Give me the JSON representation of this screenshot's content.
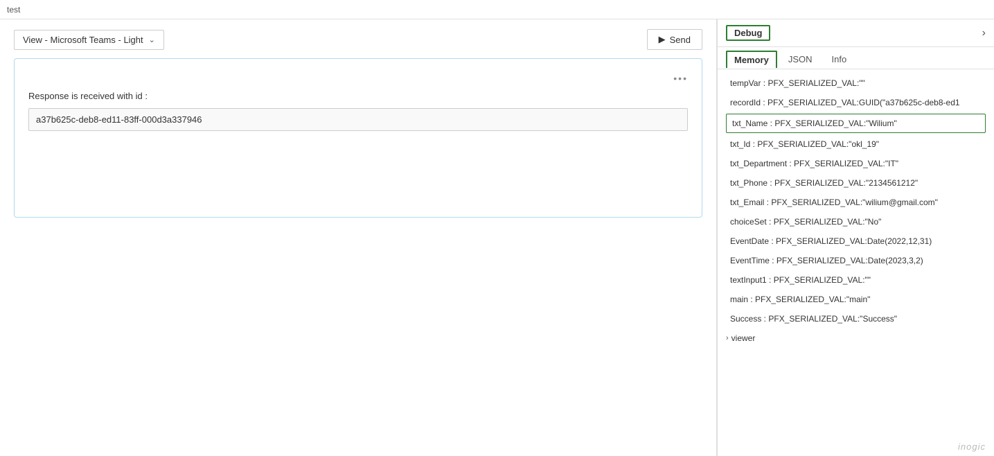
{
  "topbar": {
    "title": "test"
  },
  "toolbar": {
    "view_label": "View - Microsoft Teams - Light",
    "send_label": "Send",
    "send_icon": "▷"
  },
  "card": {
    "options_icon": "•••",
    "response_label": "Response is received with id :",
    "record_id": "a37b625c-deb8-ed11-83ff-000d3a337946"
  },
  "debug": {
    "title": "Debug",
    "chevron": "›",
    "tabs": [
      {
        "label": "Memory",
        "active": true
      },
      {
        "label": "JSON",
        "active": false
      },
      {
        "label": "Info",
        "active": false
      }
    ],
    "memory_items": [
      {
        "text": "tempVar : PFX_SERIALIZED_VAL:\"\"",
        "highlighted": false
      },
      {
        "text": "recordId : PFX_SERIALIZED_VAL:GUID(\"a37b625c-deb8-ed1",
        "highlighted": false
      },
      {
        "text": "txt_Name : PFX_SERIALIZED_VAL:\"Wilium\"",
        "highlighted": true
      },
      {
        "text": "txt_Id : PFX_SERIALIZED_VAL:\"okl_19\"",
        "highlighted": false
      },
      {
        "text": "txt_Department : PFX_SERIALIZED_VAL:\"IT\"",
        "highlighted": false
      },
      {
        "text": "txt_Phone : PFX_SERIALIZED_VAL:\"2134561212\"",
        "highlighted": false
      },
      {
        "text": "txt_Email : PFX_SERIALIZED_VAL:\"wilium@gmail.com\"",
        "highlighted": false
      },
      {
        "text": "choiceSet : PFX_SERIALIZED_VAL:\"No\"",
        "highlighted": false
      },
      {
        "text": "EventDate : PFX_SERIALIZED_VAL:Date(2022,12,31)",
        "highlighted": false
      },
      {
        "text": "EventTime : PFX_SERIALIZED_VAL:Date(2023,3,2)",
        "highlighted": false
      },
      {
        "text": "textInput1 : PFX_SERIALIZED_VAL:\"\"",
        "highlighted": false
      },
      {
        "text": "main : PFX_SERIALIZED_VAL:\"main\"",
        "highlighted": false
      },
      {
        "text": "Success : PFX_SERIALIZED_VAL:\"Success\"",
        "highlighted": false
      }
    ],
    "viewer_label": "viewer",
    "footer_watermark": "inogic"
  }
}
